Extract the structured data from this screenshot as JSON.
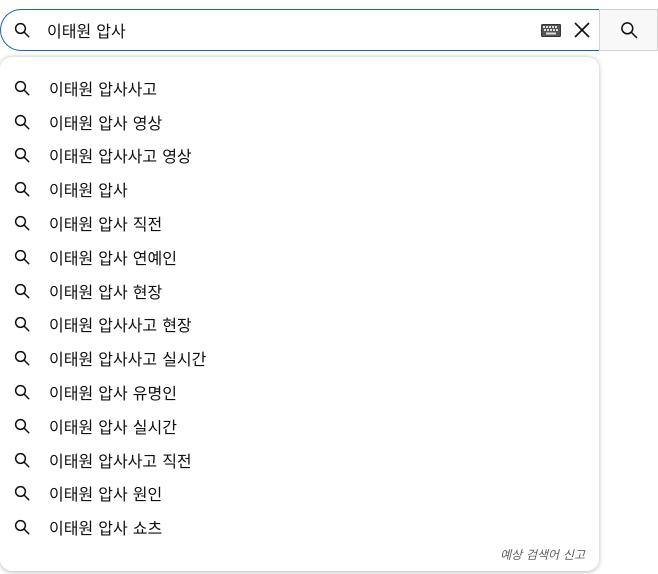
{
  "search": {
    "query": "이태원 압사"
  },
  "suggestions": [
    "이태원 압사사고",
    "이태원 압사 영상",
    "이태원 압사사고 영상",
    "이태원 압사",
    "이태원 압사 직전",
    "이태원 압사 연예인",
    "이태원 압사 현장",
    "이태원 압사사고 현장",
    "이태원 압사사고 실시간",
    "이태원 압사 유명인",
    "이태원 압사 실시간",
    "이태원 압사사고 직전",
    "이태원 압사 원인",
    "이태원 압사 쇼츠"
  ],
  "report_label": "예상 검색어 신고",
  "icons": {
    "search": "search-icon",
    "keyboard": "keyboard-icon",
    "clear": "close-icon"
  },
  "colors": {
    "focus_border": "#1c62b9",
    "button_bg": "#f8f8f8"
  }
}
